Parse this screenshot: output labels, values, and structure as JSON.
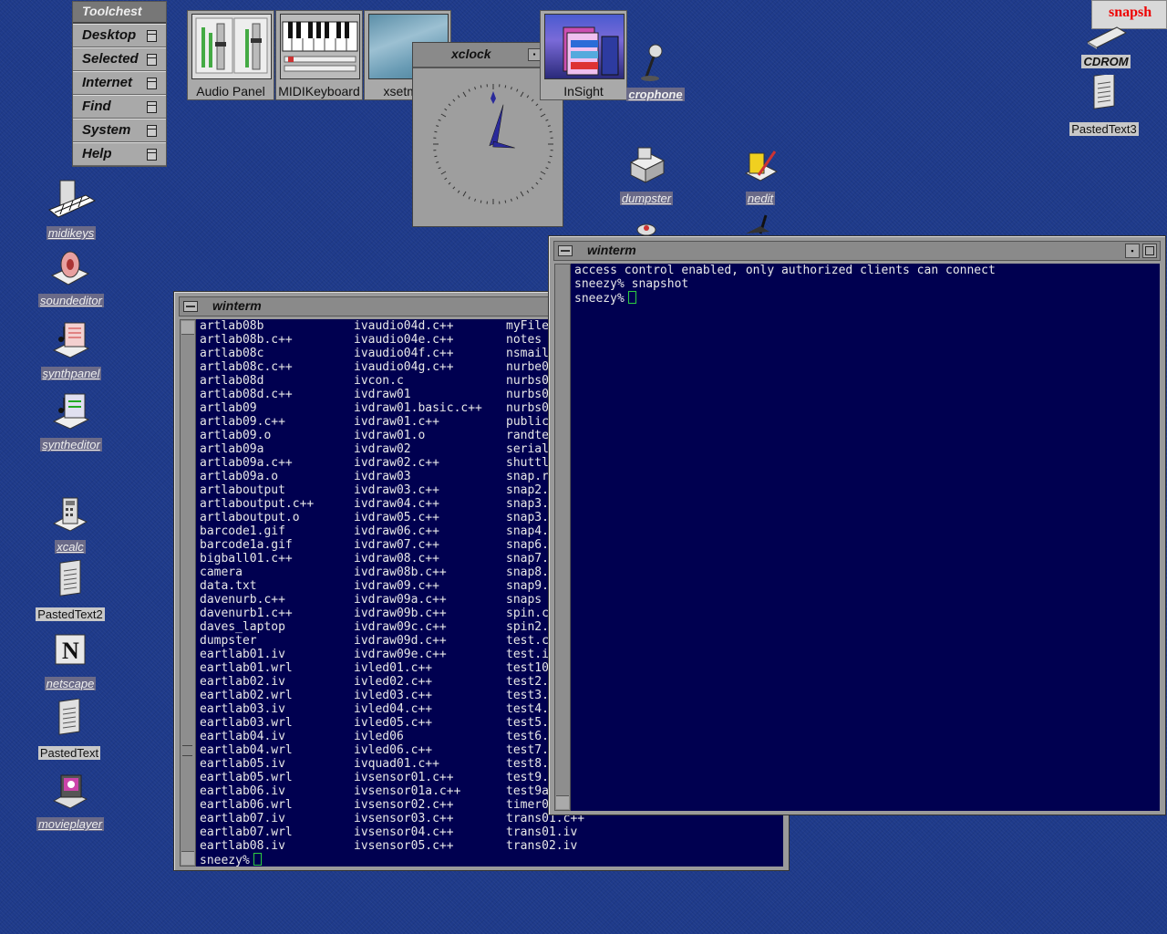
{
  "toolchest": {
    "title": "Toolchest",
    "items": [
      "Desktop",
      "Selected",
      "Internet",
      "Find",
      "System",
      "Help"
    ]
  },
  "panels": [
    "Audio Panel",
    "MIDIKeyboard",
    "xsetmon",
    "InSight"
  ],
  "xclock": {
    "title": "xclock"
  },
  "snapshot_tab": "snapsh",
  "desktop_icons": {
    "cdrom": "CDROM",
    "pastedtext3": "PastedText3",
    "microphone": "crophone",
    "dumpster": "dumpster",
    "nedit": "nedit",
    "midikeys": "midikeys",
    "soundeditor": "soundeditor",
    "synthpanel": "synthpanel",
    "syntheditor": "syntheditor",
    "xcalc": "xcalc",
    "pastedtext2": "PastedText2",
    "netscape": "netscape",
    "pastedtext": "PastedText",
    "movieplayer": "movieplayer"
  },
  "winterm_left": {
    "title": "winterm",
    "col1": [
      "artlab08b",
      "artlab08b.c++",
      "artlab08c",
      "artlab08c.c++",
      "artlab08d",
      "artlab08d.c++",
      "artlab09",
      "artlab09.c++",
      "artlab09.o",
      "artlab09a",
      "artlab09a.c++",
      "artlab09a.o",
      "artlaboutput",
      "artlaboutput.c++",
      "artlaboutput.o",
      "barcode1.gif",
      "barcode1a.gif",
      "bigball01.c++",
      "camera",
      "data.txt",
      "davenurb.c++",
      "davenurb1.c++",
      "daves_laptop",
      "dumpster",
      "eartlab01.iv",
      "eartlab01.wrl",
      "eartlab02.iv",
      "eartlab02.wrl",
      "eartlab03.iv",
      "eartlab03.wrl",
      "eartlab04.iv",
      "eartlab04.wrl",
      "eartlab05.iv",
      "eartlab05.wrl",
      "eartlab06.iv",
      "eartlab06.wrl",
      "eartlab07.iv",
      "eartlab07.wrl",
      "eartlab08.iv"
    ],
    "col2": [
      "ivaudio04d.c++",
      "ivaudio04e.c++",
      "ivaudio04f.c++",
      "ivaudio04g.c++",
      "ivcon.c",
      "ivdraw01",
      "ivdraw01.basic.c++",
      "ivdraw01.c++",
      "ivdraw01.o",
      "ivdraw02",
      "ivdraw02.c++",
      "ivdraw03",
      "ivdraw03.c++",
      "ivdraw04.c++",
      "ivdraw05.c++",
      "ivdraw06.c++",
      "ivdraw07.c++",
      "ivdraw08.c++",
      "ivdraw08b.c++",
      "ivdraw09.c++",
      "ivdraw09a.c++",
      "ivdraw09b.c++",
      "ivdraw09c.c++",
      "ivdraw09d.c++",
      "ivdraw09e.c++",
      "ivled01.c++",
      "ivled02.c++",
      "ivled03.c++",
      "ivled04.c++",
      "ivled05.c++",
      "ivled06",
      "ivled06.c++",
      "ivquad01.c++",
      "ivsensor01.c++",
      "ivsensor01a.c++",
      "ivsensor02.c++",
      "ivsensor03.c++",
      "ivsensor04.c++",
      "ivsensor05.c++"
    ],
    "col3": [
      "myFile",
      "notes",
      "nsmail",
      "nurbe0",
      "nurbs0",
      "nurbs0",
      "nurbs0",
      "public",
      "randte",
      "serial",
      "shuttl",
      "snap.r",
      "snap2.",
      "snap3.",
      "snap3.",
      "snap4.",
      "snap6.",
      "snap7.",
      "snap8.",
      "snap9.",
      "snaps",
      "spin.c",
      "spin2.",
      "test.c",
      "test.i",
      "test10",
      "test2.",
      "test3.",
      "test4.",
      "test5.",
      "test6.",
      "test7.",
      "test8.",
      "test9.",
      "test9a",
      "timer0",
      "trans01.c++",
      "trans01.iv",
      "trans02.iv"
    ],
    "prompt": "sneezy%"
  },
  "winterm_right": {
    "title": "winterm",
    "lines": [
      "access control enabled, only authorized clients can connect",
      "sneezy% snapshot"
    ],
    "prompt": "sneezy%"
  }
}
